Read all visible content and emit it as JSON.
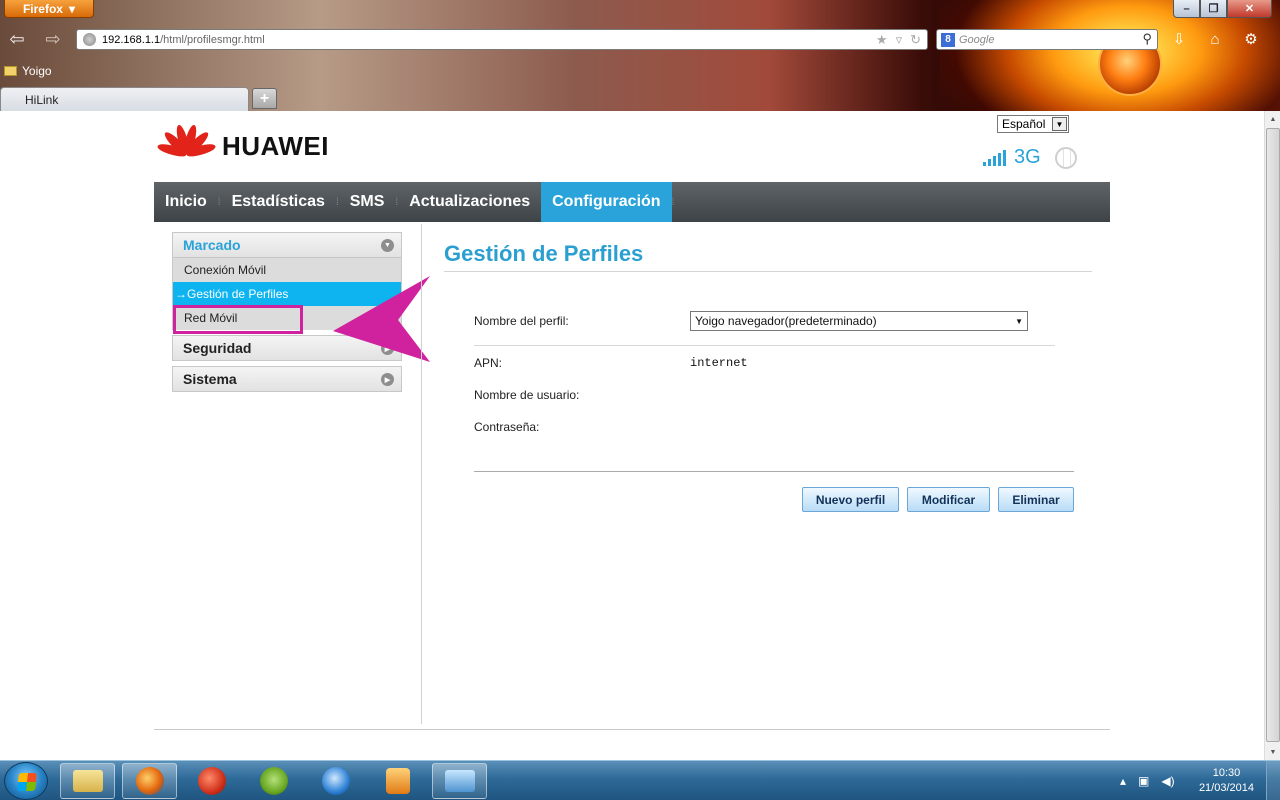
{
  "browser": {
    "menu_button": "Firefox",
    "url_host": "192.168.1.1",
    "url_path": "/html/profilesmgr.html",
    "search_placeholder": "Google",
    "bookmark": "Yoigo",
    "tab_title": "HiLink",
    "new_tab": "+"
  },
  "header": {
    "language": "Español",
    "brand": "HUAWEI",
    "network_type": "3G"
  },
  "main_nav": [
    {
      "label": "Inicio"
    },
    {
      "label": "Estadísticas"
    },
    {
      "label": "SMS"
    },
    {
      "label": "Actualizaciones"
    },
    {
      "label": "Configuración",
      "active": true
    }
  ],
  "side_menu": {
    "marcado": "Marcado",
    "items": [
      "Conexión Móvil",
      "→Gestión de Perfiles",
      "Red Móvil"
    ],
    "seguridad": "Seguridad",
    "sistema": "Sistema"
  },
  "content": {
    "title": "Gestión de Perfiles",
    "profile_label": "Nombre del perfil:",
    "profile_value": "Yoigo navegador(predeterminado)",
    "apn_label": "APN:",
    "apn_value": "internet",
    "user_label": "Nombre de usuario:",
    "password_label": "Contraseña:",
    "buttons": {
      "new": "Nuevo perfil",
      "modify": "Modificar",
      "delete": "Eliminar"
    }
  },
  "taskbar": {
    "time": "10:30",
    "date": "21/03/2014"
  },
  "colors": {
    "accent": "#29a3d9",
    "annotation": "#d0229f",
    "nav_bg": "#4a5054"
  }
}
